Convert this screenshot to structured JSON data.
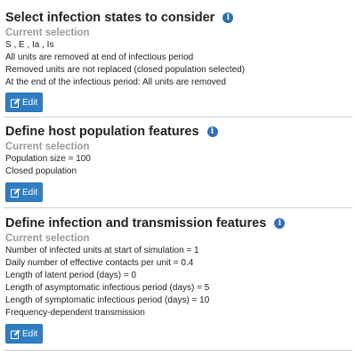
{
  "sections": [
    {
      "title": "Select infection states to consider",
      "subtitle": "Current selection",
      "lines": [
        "S , E , Ia , Is",
        "All units are removed at end of infectious period",
        "Removed units are not replaced (closed population selected)",
        "At the end of the infectious period: All units are removed"
      ],
      "edit_label": "Edit"
    },
    {
      "title": "Define host population features",
      "subtitle": "Current selection",
      "lines": [
        "Population size = 100",
        "Closed population"
      ],
      "edit_label": "Edit"
    },
    {
      "title": "Define infection and transmission features",
      "subtitle": "Current selection",
      "lines": [
        "Number of infected units at start of simulation = 1",
        "Daily number of effective contacts per unit = 0.4",
        "Length of latent period (days) = 0",
        "Length of asymptomatic infectious period (days) = 5",
        "Length of symptomatic infectious period (days) = 10",
        "Frequency-dependent transmission"
      ],
      "edit_label": "Edit"
    }
  ],
  "icons": {
    "info": "info-icon",
    "edit": "edit-icon"
  },
  "colors": {
    "accent": "#2f7ec3",
    "info": "#2f6fb5",
    "subtitle": "#9a9a9a"
  }
}
